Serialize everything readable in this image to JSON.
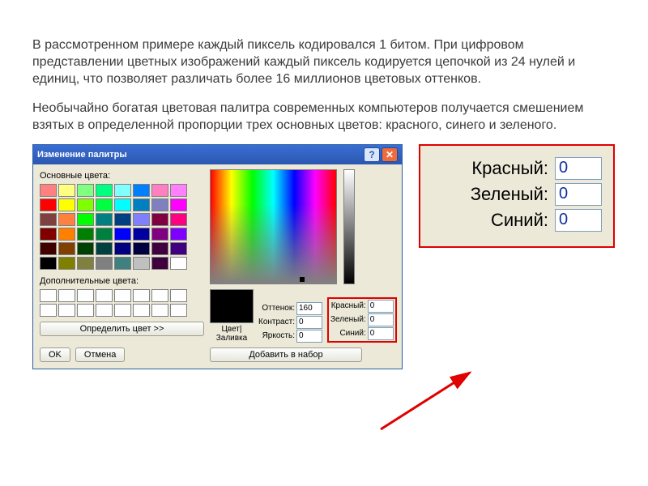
{
  "paragraph1": "В рассмотренном примере каждый пиксель кодировался 1 битом. При цифровом представлении цветных изображений каждый пиксель кодируется цепочкой из 24 нулей и единиц, что позволяет различать более 16 миллионов цветовых оттенков.",
  "paragraph2": "Необычайно богатая цветовая палитра современных компьютеров получается смешением взятых в определенной пропорции трех основных цветов: красного, синего и зеленого.",
  "dialog": {
    "title": "Изменение палитры",
    "basic_label": "Основные цвета:",
    "custom_label": "Дополнительные цвета:",
    "define_btn": "Определить цвет >>",
    "ok": "OK",
    "cancel": "Отмена",
    "add_btn": "Добавить в набор",
    "fill_label": "Цвет|Заливка",
    "hsl": {
      "hue_label": "Оттенок:",
      "hue": "160",
      "sat_label": "Контраст:",
      "sat": "0",
      "lum_label": "Яркость:",
      "lum": "0"
    },
    "rgb": {
      "r_label": "Красный:",
      "r": "0",
      "g_label": "Зеленый:",
      "g": "0",
      "b_label": "Синий:",
      "b": "0"
    },
    "basic_colors": [
      [
        "#ff8080",
        "#ffff80",
        "#80ff80",
        "#00ff80",
        "#80ffff",
        "#0080ff",
        "#ff80c0",
        "#ff80ff"
      ],
      [
        "#ff0000",
        "#ffff00",
        "#80ff00",
        "#00ff40",
        "#00ffff",
        "#0080c0",
        "#8080c0",
        "#ff00ff"
      ],
      [
        "#804040",
        "#ff8040",
        "#00ff00",
        "#008080",
        "#004080",
        "#8080ff",
        "#800040",
        "#ff0080"
      ],
      [
        "#800000",
        "#ff8000",
        "#008000",
        "#008040",
        "#0000ff",
        "#0000a0",
        "#800080",
        "#8000ff"
      ],
      [
        "#400000",
        "#804000",
        "#004000",
        "#004040",
        "#000080",
        "#000040",
        "#400040",
        "#400080"
      ],
      [
        "#000000",
        "#808000",
        "#808040",
        "#808080",
        "#408080",
        "#c0c0c0",
        "#400040",
        "#ffffff"
      ]
    ]
  },
  "zoom": {
    "r_label": "Красный:",
    "r": "0",
    "g_label": "Зеленый:",
    "g": "0",
    "b_label": "Синий:",
    "b": "0"
  }
}
